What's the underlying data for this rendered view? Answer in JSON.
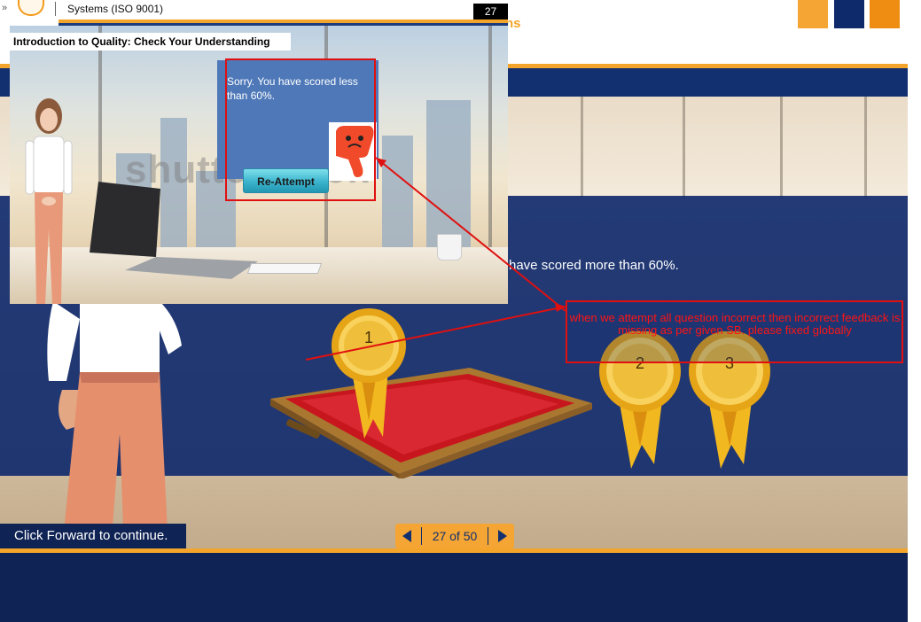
{
  "window": {
    "title": "Systems (ISO 9001)",
    "slide_count_badge": "27"
  },
  "popup": {
    "title": "Introduction to Quality: Check Your Understanding",
    "watermark": "shutterstock",
    "feedback_text": "Sorry. You have scored less than 60%.",
    "reattempt_button": "Re-Attempt",
    "thumb_icon": "thumbs-down-icon"
  },
  "slide": {
    "partial_heading": "ns",
    "scored_more_text": "have scored more than 60%.",
    "medals": [
      "1",
      "2",
      "3"
    ],
    "footer_text": "Click Forward to continue.",
    "pager": {
      "label": "27 of 50"
    }
  },
  "annotation": {
    "text": "when we attempt all question incorrect  then incorrect feedback is missing as per given SB. please fixed globally"
  },
  "colors": {
    "navy": "#12306f",
    "orange": "#f3a52b",
    "annotation_red": "#e01010",
    "feedback_blue": "#4e78b8"
  }
}
